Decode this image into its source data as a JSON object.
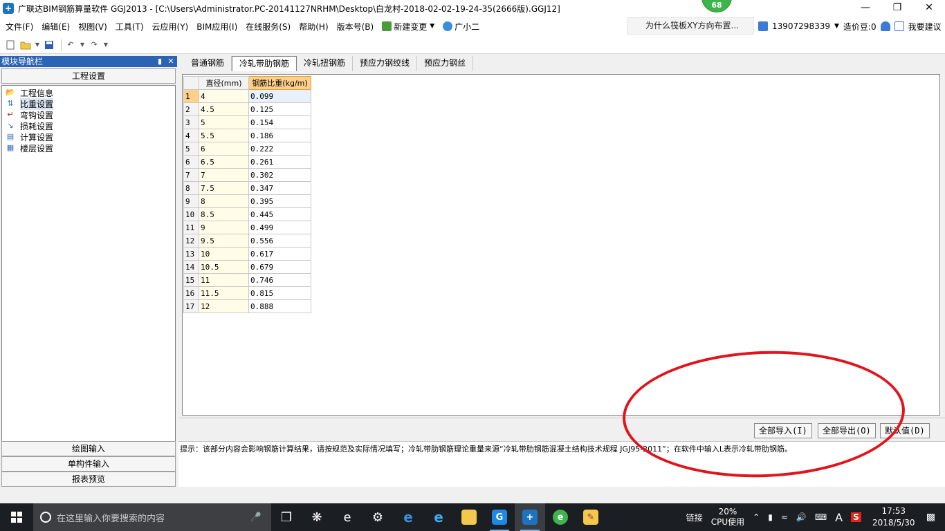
{
  "window": {
    "title": "广联达BIM钢筋算量软件 GGJ2013 - [C:\\Users\\Administrator.PC-20141127NRHM\\Desktop\\白龙村-2018-02-02-19-24-35(2666版).GGJ12]",
    "badge": "68",
    "app_icon": "glodon-icon"
  },
  "menu": {
    "items": [
      "文件(F)",
      "编辑(E)",
      "视图(V)",
      "工具(T)",
      "云应用(Y)",
      "BIM应用(I)",
      "在线服务(S)",
      "帮助(H)",
      "版本号(B)"
    ],
    "new_change": "新建变更",
    "assistant": "广小二",
    "ad_text": "为什么筏板XY方向布置...",
    "phone": "13907298339",
    "coins": "造价豆:0",
    "feedback": "我要建议"
  },
  "nav": {
    "header": "模块导航栏",
    "section_top": "工程设置",
    "tree": [
      {
        "label": "工程信息",
        "icon": "info-folder-icon"
      },
      {
        "label": "比重设置",
        "icon": "weight-settings-icon"
      },
      {
        "label": "弯钩设置",
        "icon": "hook-settings-icon"
      },
      {
        "label": "损耗设置",
        "icon": "loss-settings-icon"
      },
      {
        "label": "计算设置",
        "icon": "calc-settings-icon"
      },
      {
        "label": "楼层设置",
        "icon": "floor-settings-icon"
      }
    ],
    "sections_bottom": [
      "绘图输入",
      "单构件输入",
      "报表预览"
    ]
  },
  "tabs": [
    "普通钢筋",
    "冷轧带肋钢筋",
    "冷轧扭钢筋",
    "预应力钢绞线",
    "预应力钢丝"
  ],
  "active_tab": 1,
  "grid": {
    "headers": [
      "直径(mm)",
      "钢筋比重(kg/m)"
    ],
    "rows": [
      [
        "1",
        "4",
        "0.099"
      ],
      [
        "2",
        "4.5",
        "0.125"
      ],
      [
        "3",
        "5",
        "0.154"
      ],
      [
        "4",
        "5.5",
        "0.186"
      ],
      [
        "5",
        "6",
        "0.222"
      ],
      [
        "6",
        "6.5",
        "0.261"
      ],
      [
        "7",
        "7",
        "0.302"
      ],
      [
        "8",
        "7.5",
        "0.347"
      ],
      [
        "9",
        "8",
        "0.395"
      ],
      [
        "10",
        "8.5",
        "0.445"
      ],
      [
        "11",
        "9",
        "0.499"
      ],
      [
        "12",
        "9.5",
        "0.556"
      ],
      [
        "13",
        "10",
        "0.617"
      ],
      [
        "14",
        "10.5",
        "0.679"
      ],
      [
        "15",
        "11",
        "0.746"
      ],
      [
        "16",
        "11.5",
        "0.815"
      ],
      [
        "17",
        "12",
        "0.888"
      ]
    ]
  },
  "buttons": {
    "import_all": "全部导入(I)",
    "export_all": "全部导出(O)",
    "default": "默认值(D)"
  },
  "hint": "提示：该部分内容会影响钢筋计算结果，请按规范及实际情况填写；冷轧带肋钢筋理论重量来源“冷轧带肋钢筋混凝土结构技术规程 JGJ95-2011”；在软件中输入L表示冷轧带肋钢筋。",
  "taskbar": {
    "search_placeholder": "在这里输入你要搜索的内容",
    "tray_link": "链接",
    "cpu_percent": "20%",
    "cpu_label": "CPU使用",
    "ime": "A",
    "time": "17:53",
    "date": "2018/5/30",
    "notifications": "1"
  },
  "colors": {
    "nav_header": "#2b63b5",
    "annotation": "#e0141c",
    "selected_header": "#ffd08a"
  }
}
